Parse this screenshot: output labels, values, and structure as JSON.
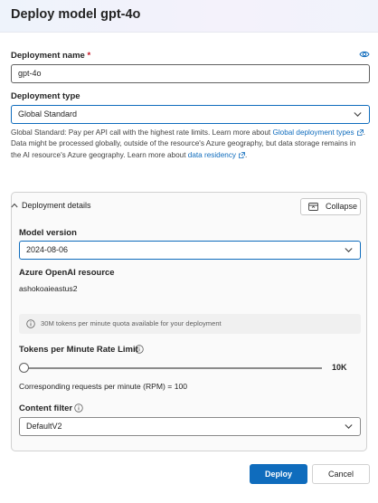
{
  "dialog": {
    "title": "Deploy model gpt-4o"
  },
  "deployment_name": {
    "label": "Deployment name",
    "required_marker": "*",
    "value": "gpt-4o"
  },
  "deployment_type": {
    "label": "Deployment type",
    "selected": "Global Standard",
    "help_line1_prefix": "Global Standard: Pay per API call with the highest rate limits. Learn more about ",
    "help_link1": "Global deployment types",
    "help_line2_prefix": "Data might be processed globally, outside of the resource's Azure geography, but data storage remains in the AI resource's Azure geography. Learn more about ",
    "help_link2": "data residency",
    "help_suffix": "."
  },
  "details": {
    "title": "Deployment details",
    "collapse_label": "Collapse",
    "model_version_label": "Model version",
    "model_version_value": "2024-08-06",
    "resource_label": "Azure OpenAI resource",
    "resource_value": "ashokoaieastus2",
    "quota_info": "30M tokens per minute quota available for your deployment",
    "tpm_label": "Tokens per Minute Rate Limit",
    "tpm_value_fraction": 0,
    "tpm_max": "10K",
    "rpm_text": "Corresponding requests per minute (RPM) = 100",
    "content_filter_label": "Content filter",
    "content_filter_value": "DefaultV2"
  },
  "footer": {
    "deploy_label": "Deploy",
    "cancel_label": "Cancel"
  },
  "colors": {
    "accent": "#0f6cbd",
    "required": "#c50f1f"
  },
  "icons": [
    "eye-icon",
    "chevron-down-icon",
    "external-link-icon",
    "chevron-up-icon",
    "collapse-icon",
    "info-icon"
  ]
}
